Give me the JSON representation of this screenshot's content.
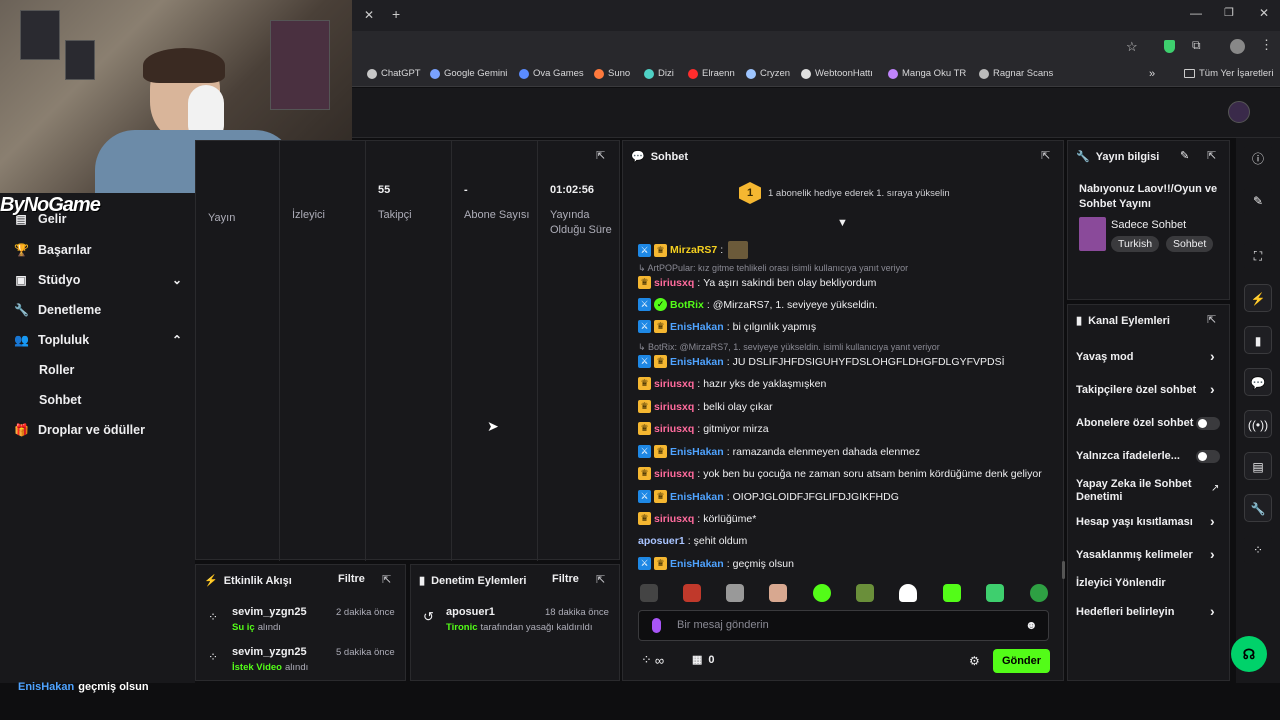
{
  "browser": {
    "bookmarks": [
      {
        "label": "ChatGPT",
        "color": "#c8c8c8"
      },
      {
        "label": "Google Gemini",
        "color": "#7aa2ff"
      },
      {
        "label": "Ova Games",
        "color": "#5b8cff"
      },
      {
        "label": "Suno",
        "color": "#ff7a3d"
      },
      {
        "label": "Dizi",
        "color": "#4fd1c5"
      },
      {
        "label": "Elraenn",
        "color": "#ff2d2d"
      },
      {
        "label": "Cryzen",
        "color": "#9ec5ff"
      },
      {
        "label": "WebtoonHattı",
        "color": "#e0e0e0"
      },
      {
        "label": "Manga Oku TR",
        "color": "#c084fc"
      },
      {
        "label": "Ragnar Scans",
        "color": "#bbbbbb"
      }
    ],
    "bookmarks_folder": "Tüm Yer İşaretleri"
  },
  "overlay": {
    "logo_text": "ByNoGame"
  },
  "sidebar": {
    "items": [
      {
        "label": "Gelir",
        "icon": "money-icon"
      },
      {
        "label": "Başarılar",
        "icon": "trophy-icon"
      },
      {
        "label": "Stüdyo",
        "icon": "studio-icon",
        "chevron": "⌄"
      },
      {
        "label": "Denetleme",
        "icon": "wrench-icon"
      },
      {
        "label": "Topluluk",
        "icon": "users-icon",
        "chevron": "⌃"
      }
    ],
    "subitems": [
      "Roller",
      "Sohbet"
    ],
    "drops": "Droplar ve ödüller"
  },
  "stats": {
    "columns": [
      {
        "value": "",
        "label": "Yayın"
      },
      {
        "value": "",
        "label": "İzleyici"
      },
      {
        "value": "55",
        "label": "Takipçi"
      },
      {
        "value": "-",
        "label": "Abone Sayısı"
      },
      {
        "value": "01:02:56",
        "label": "Yayında Olduğu Süre"
      }
    ]
  },
  "activity": {
    "title": "Etkinlik Akışı",
    "filter": "Filtre",
    "events": [
      {
        "user": "sevim_yzgn25",
        "time": "2 dakika önce",
        "item": "Su iç",
        "suffix": "alındı"
      },
      {
        "user": "sevim_yzgn25",
        "time": "5 dakika önce",
        "item": "İstek Video",
        "suffix": "alındı"
      }
    ]
  },
  "moderation": {
    "title": "Denetim Eylemleri",
    "filter": "Filtre",
    "events": [
      {
        "user": "aposuer1",
        "time": "18 dakika önce",
        "actor": "Tironic",
        "text": "tarafından yasağı kaldırıldı"
      }
    ]
  },
  "chat": {
    "title": "Sohbet",
    "pinned_badge": "1",
    "pinned_text": "1 abonelik hediye ederek 1. sıraya yükselin",
    "messages": [
      {
        "type": "msg",
        "user": "MirzaRS7",
        "color": "#f5d020",
        "badges": [
          "blue",
          "gold"
        ],
        "text": "",
        "emote": true
      },
      {
        "type": "reply",
        "text": "↳ ArtPOPular: kız gitme tehlikeli orası isimli kullanıcıya yanıt veriyor"
      },
      {
        "type": "msg",
        "user": "siriusxq",
        "color": "#ff6b9d",
        "badges": [
          "gold"
        ],
        "text": "Ya aşırı sakindi ben olay bekliyordum"
      },
      {
        "type": "msg",
        "user": "BotRix",
        "color": "#53fc18",
        "badges": [
          "blue",
          "green"
        ],
        "text": "@MirzaRS7, 1. seviyeye yükseldin."
      },
      {
        "type": "msg",
        "user": "EnisHakan",
        "color": "#4fa3ff",
        "badges": [
          "blue",
          "gold"
        ],
        "text": "bi çılgınlık yapmış"
      },
      {
        "type": "reply",
        "text": "↳ BotRix: @MirzaRS7, 1. seviyeye yükseldin. isimli kullanıcıya yanıt veriyor"
      },
      {
        "type": "msg",
        "user": "EnisHakan",
        "color": "#4fa3ff",
        "badges": [
          "blue",
          "gold"
        ],
        "text": "JU DSLIFJHFDSIGUHYFDSLOHGFLDHGFDLGYFVPDSİ"
      },
      {
        "type": "msg",
        "user": "siriusxq",
        "color": "#ff6b9d",
        "badges": [
          "gold"
        ],
        "text": "hazır yks de yaklaşmışken"
      },
      {
        "type": "msg",
        "user": "siriusxq",
        "color": "#ff6b9d",
        "badges": [
          "gold"
        ],
        "text": "belki olay çıkar"
      },
      {
        "type": "msg",
        "user": "siriusxq",
        "color": "#ff6b9d",
        "badges": [
          "gold"
        ],
        "text": "gitmiyor mirza"
      },
      {
        "type": "msg",
        "user": "EnisHakan",
        "color": "#4fa3ff",
        "badges": [
          "blue",
          "gold"
        ],
        "text": "ramazanda elenmeyen dahada elenmez"
      },
      {
        "type": "msg",
        "user": "siriusxq",
        "color": "#ff6b9d",
        "badges": [
          "gold"
        ],
        "text": "yok ben bu çocuğa ne zaman soru atsam benim kördüğüme denk geliyor"
      },
      {
        "type": "msg",
        "user": "EnisHakan",
        "color": "#4fa3ff",
        "badges": [
          "blue",
          "gold"
        ],
        "text": "OIOPJGLOIDFJFGLIFDJGIKFHDG"
      },
      {
        "type": "msg",
        "user": "siriusxq",
        "color": "#ff6b9d",
        "badges": [
          "gold"
        ],
        "text": "körlüğüme*"
      },
      {
        "type": "msg",
        "user": "aposuer1",
        "color": "#a9c4ff",
        "badges": [],
        "text": "şehit oldum"
      },
      {
        "type": "msg",
        "user": "EnisHakan",
        "color": "#4fa3ff",
        "badges": [
          "blue",
          "gold"
        ],
        "text": "geçmiş olsun"
      }
    ],
    "input_placeholder": "Bir mesaj gönderin",
    "infinity": "∞",
    "points": "0",
    "send": "Gönder"
  },
  "stream_info": {
    "title": "Yayın bilgisi",
    "stream_title": "Nabıyonuz Laov!!/Oyun ve Sohbet Yayını",
    "category": "Sadece Sohbet",
    "tags": [
      "Turkish",
      "Sohbet"
    ]
  },
  "channel_actions": {
    "title": "Kanal Eylemleri",
    "rows": [
      {
        "label": "Yavaş mod",
        "kind": "chevron"
      },
      {
        "label": "Takipçilere özel sohbet",
        "kind": "chevron"
      },
      {
        "label": "Abonelere özel sohbet",
        "kind": "toggle"
      },
      {
        "label": "Yalnızca ifadelerle...",
        "kind": "toggle"
      },
      {
        "label": "Yapay Zeka ile Sohbet Denetimi",
        "kind": "external"
      },
      {
        "label": "Hesap yaşı kısıtlaması",
        "kind": "chevron"
      },
      {
        "label": "Yasaklanmış kelimeler",
        "kind": "chevron"
      },
      {
        "label": "İzleyici Yönlendir",
        "kind": "none"
      },
      {
        "label": "Hedefleri belirleyin",
        "kind": "chevron"
      }
    ]
  },
  "bottom": {
    "user": "EnisHakan",
    "text": "geçmiş olsun"
  },
  "colors": {
    "kick_green": "#53fc18",
    "panel": "#18181b",
    "bg": "#0e0e10"
  }
}
